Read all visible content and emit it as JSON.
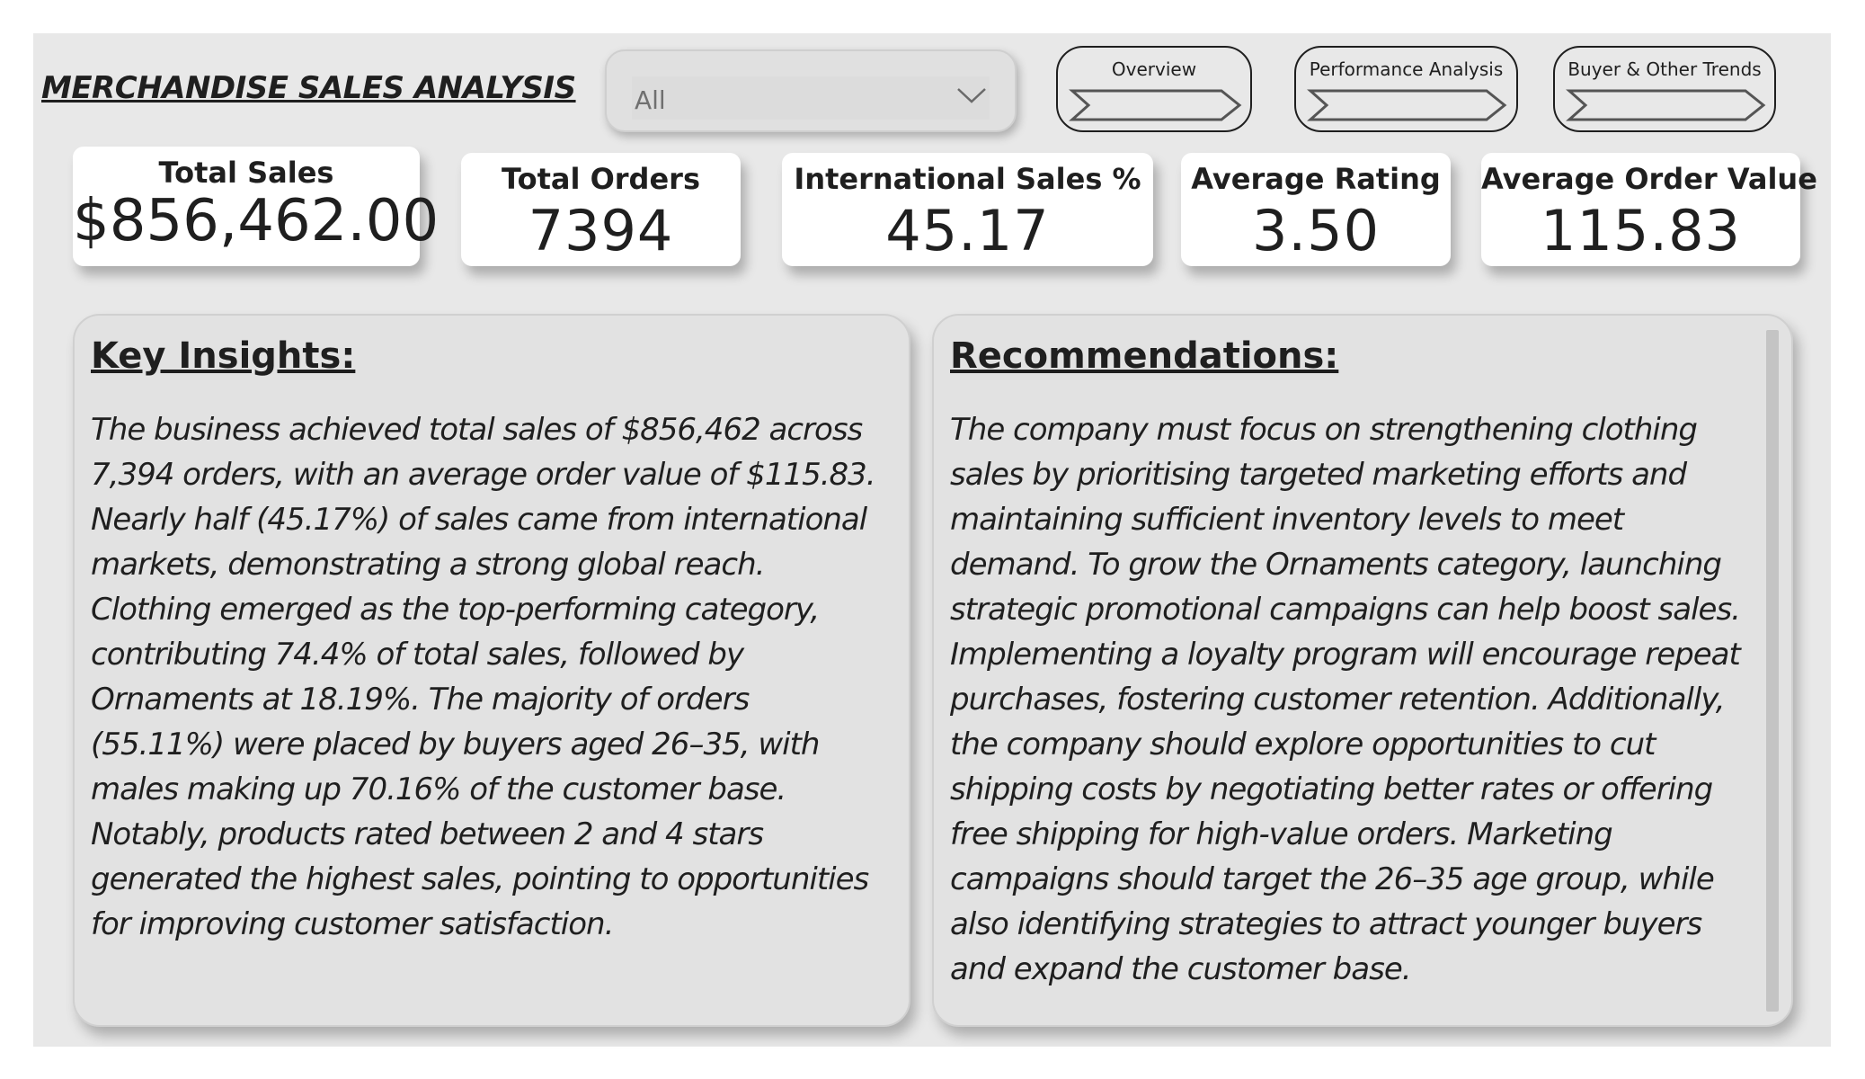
{
  "header": {
    "title": "MERCHANDISE SALES ANALYSIS",
    "slicer": {
      "selected": "All"
    },
    "nav": [
      {
        "label": "Overview"
      },
      {
        "label": "Performance Analysis"
      },
      {
        "label": "Buyer & Other Trends"
      }
    ]
  },
  "kpis": [
    {
      "title": "Total Sales",
      "value": "$856,462.00"
    },
    {
      "title": "Total Orders",
      "value": "7394"
    },
    {
      "title": "International Sales %",
      "value": "45.17"
    },
    {
      "title": "Average Rating",
      "value": "3.50"
    },
    {
      "title": "Average Order Value",
      "value": "115.83"
    }
  ],
  "insights": {
    "heading": "Key Insights:",
    "body": "The business achieved total sales of $856,462 across 7,394 orders, with an average order value of $115.83. Nearly half (45.17%) of sales came from international markets, demonstrating a strong global reach. Clothing emerged as the top-performing category, contributing 74.4% of total sales, followed by Ornaments at 18.19%. The majority of orders (55.11%) were placed by buyers aged 26–35, with males making up 70.16% of the customer base. Notably, products rated between 2 and 4 stars generated the highest sales, pointing to opportunities for improving customer satisfaction."
  },
  "recommendations": {
    "heading": "Recommendations:",
    "body": "The company must focus on strengthening clothing sales by prioritising targeted marketing efforts and maintaining sufficient inventory levels to meet demand. To grow the Ornaments category, launching strategic promotional campaigns can help boost sales. Implementing a loyalty program will encourage repeat purchases, fostering customer retention. Additionally, the company should explore opportunities to cut shipping costs by negotiating better rates or offering free shipping for high-value orders. Marketing campaigns should target the 26–35 age group, while also identifying strategies to attract younger buyers and expand the customer base."
  }
}
